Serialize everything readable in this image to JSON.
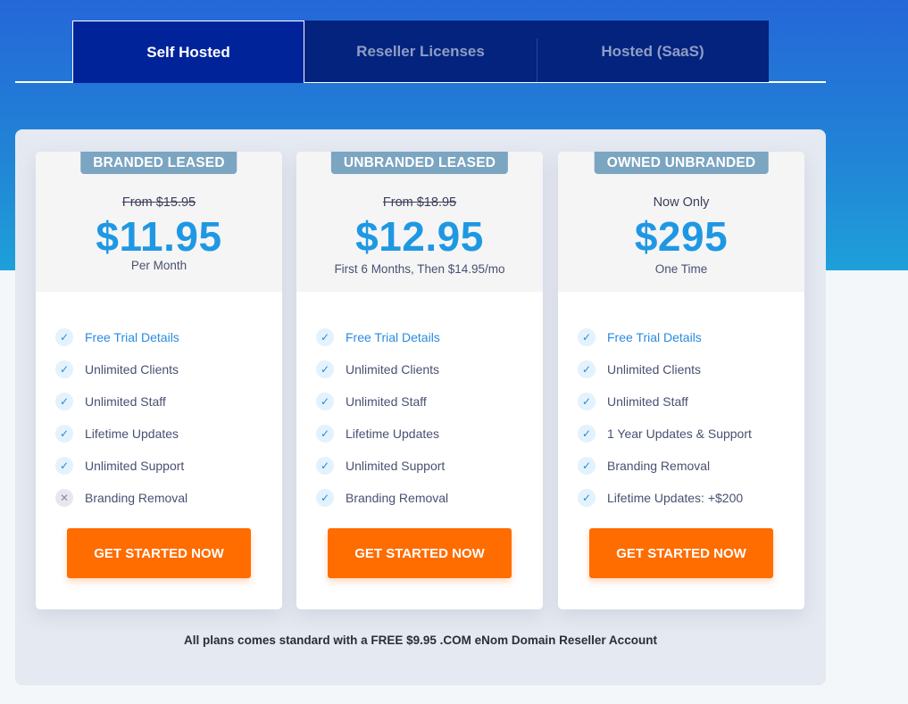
{
  "tabs": [
    {
      "label": "Self Hosted",
      "active": true
    },
    {
      "label": "Reseller Licenses",
      "active": false
    },
    {
      "label": "Hosted (SaaS)",
      "active": false
    }
  ],
  "colors": {
    "accent_price": "#1f98e3",
    "cta": "#ff6c00",
    "badge": "#7ba5c1",
    "tab_active": "#00239a",
    "tab_inactive": "#03237e"
  },
  "plans": [
    {
      "badge": "BRANDED LEASED",
      "old_price": "From $15.95",
      "price": "$11.95",
      "note": "Per Month",
      "features": [
        {
          "label": "Free Trial Details",
          "icon": "check-icon",
          "link": true
        },
        {
          "label": "Unlimited Clients",
          "icon": "check-icon"
        },
        {
          "label": "Unlimited Staff",
          "icon": "check-icon"
        },
        {
          "label": "Lifetime Updates",
          "icon": "check-icon"
        },
        {
          "label": "Unlimited Support",
          "icon": "check-icon"
        },
        {
          "label": "Branding Removal",
          "icon": "x-icon"
        }
      ],
      "cta": "GET STARTED NOW"
    },
    {
      "badge": "UNBRANDED LEASED",
      "old_price": "From $18.95",
      "price": "$12.95",
      "note": "First 6 Months, Then $14.95/mo",
      "features": [
        {
          "label": "Free Trial Details",
          "icon": "check-icon",
          "link": true
        },
        {
          "label": "Unlimited Clients",
          "icon": "check-icon"
        },
        {
          "label": "Unlimited Staff",
          "icon": "check-icon"
        },
        {
          "label": "Lifetime Updates",
          "icon": "check-icon"
        },
        {
          "label": "Unlimited Support",
          "icon": "check-icon"
        },
        {
          "label": "Branding Removal",
          "icon": "check-icon"
        }
      ],
      "cta": "GET STARTED NOW"
    },
    {
      "badge": "OWNED UNBRANDED",
      "pre_label": "Now Only",
      "price": "$295",
      "note": "One Time",
      "features": [
        {
          "label": "Free Trial Details",
          "icon": "check-icon",
          "link": true
        },
        {
          "label": "Unlimited Clients",
          "icon": "check-icon"
        },
        {
          "label": "Unlimited Staff",
          "icon": "check-icon"
        },
        {
          "label": "1 Year Updates & Support",
          "icon": "check-icon"
        },
        {
          "label": "Branding Removal",
          "icon": "check-icon"
        },
        {
          "label": "Lifetime Updates: +$200",
          "icon": "check-icon"
        }
      ],
      "cta": "GET STARTED NOW"
    }
  ],
  "footnote": "All plans comes standard with a FREE $9.95 .COM eNom Domain Reseller Account",
  "icons": {
    "check": "✓",
    "x": "✕"
  }
}
